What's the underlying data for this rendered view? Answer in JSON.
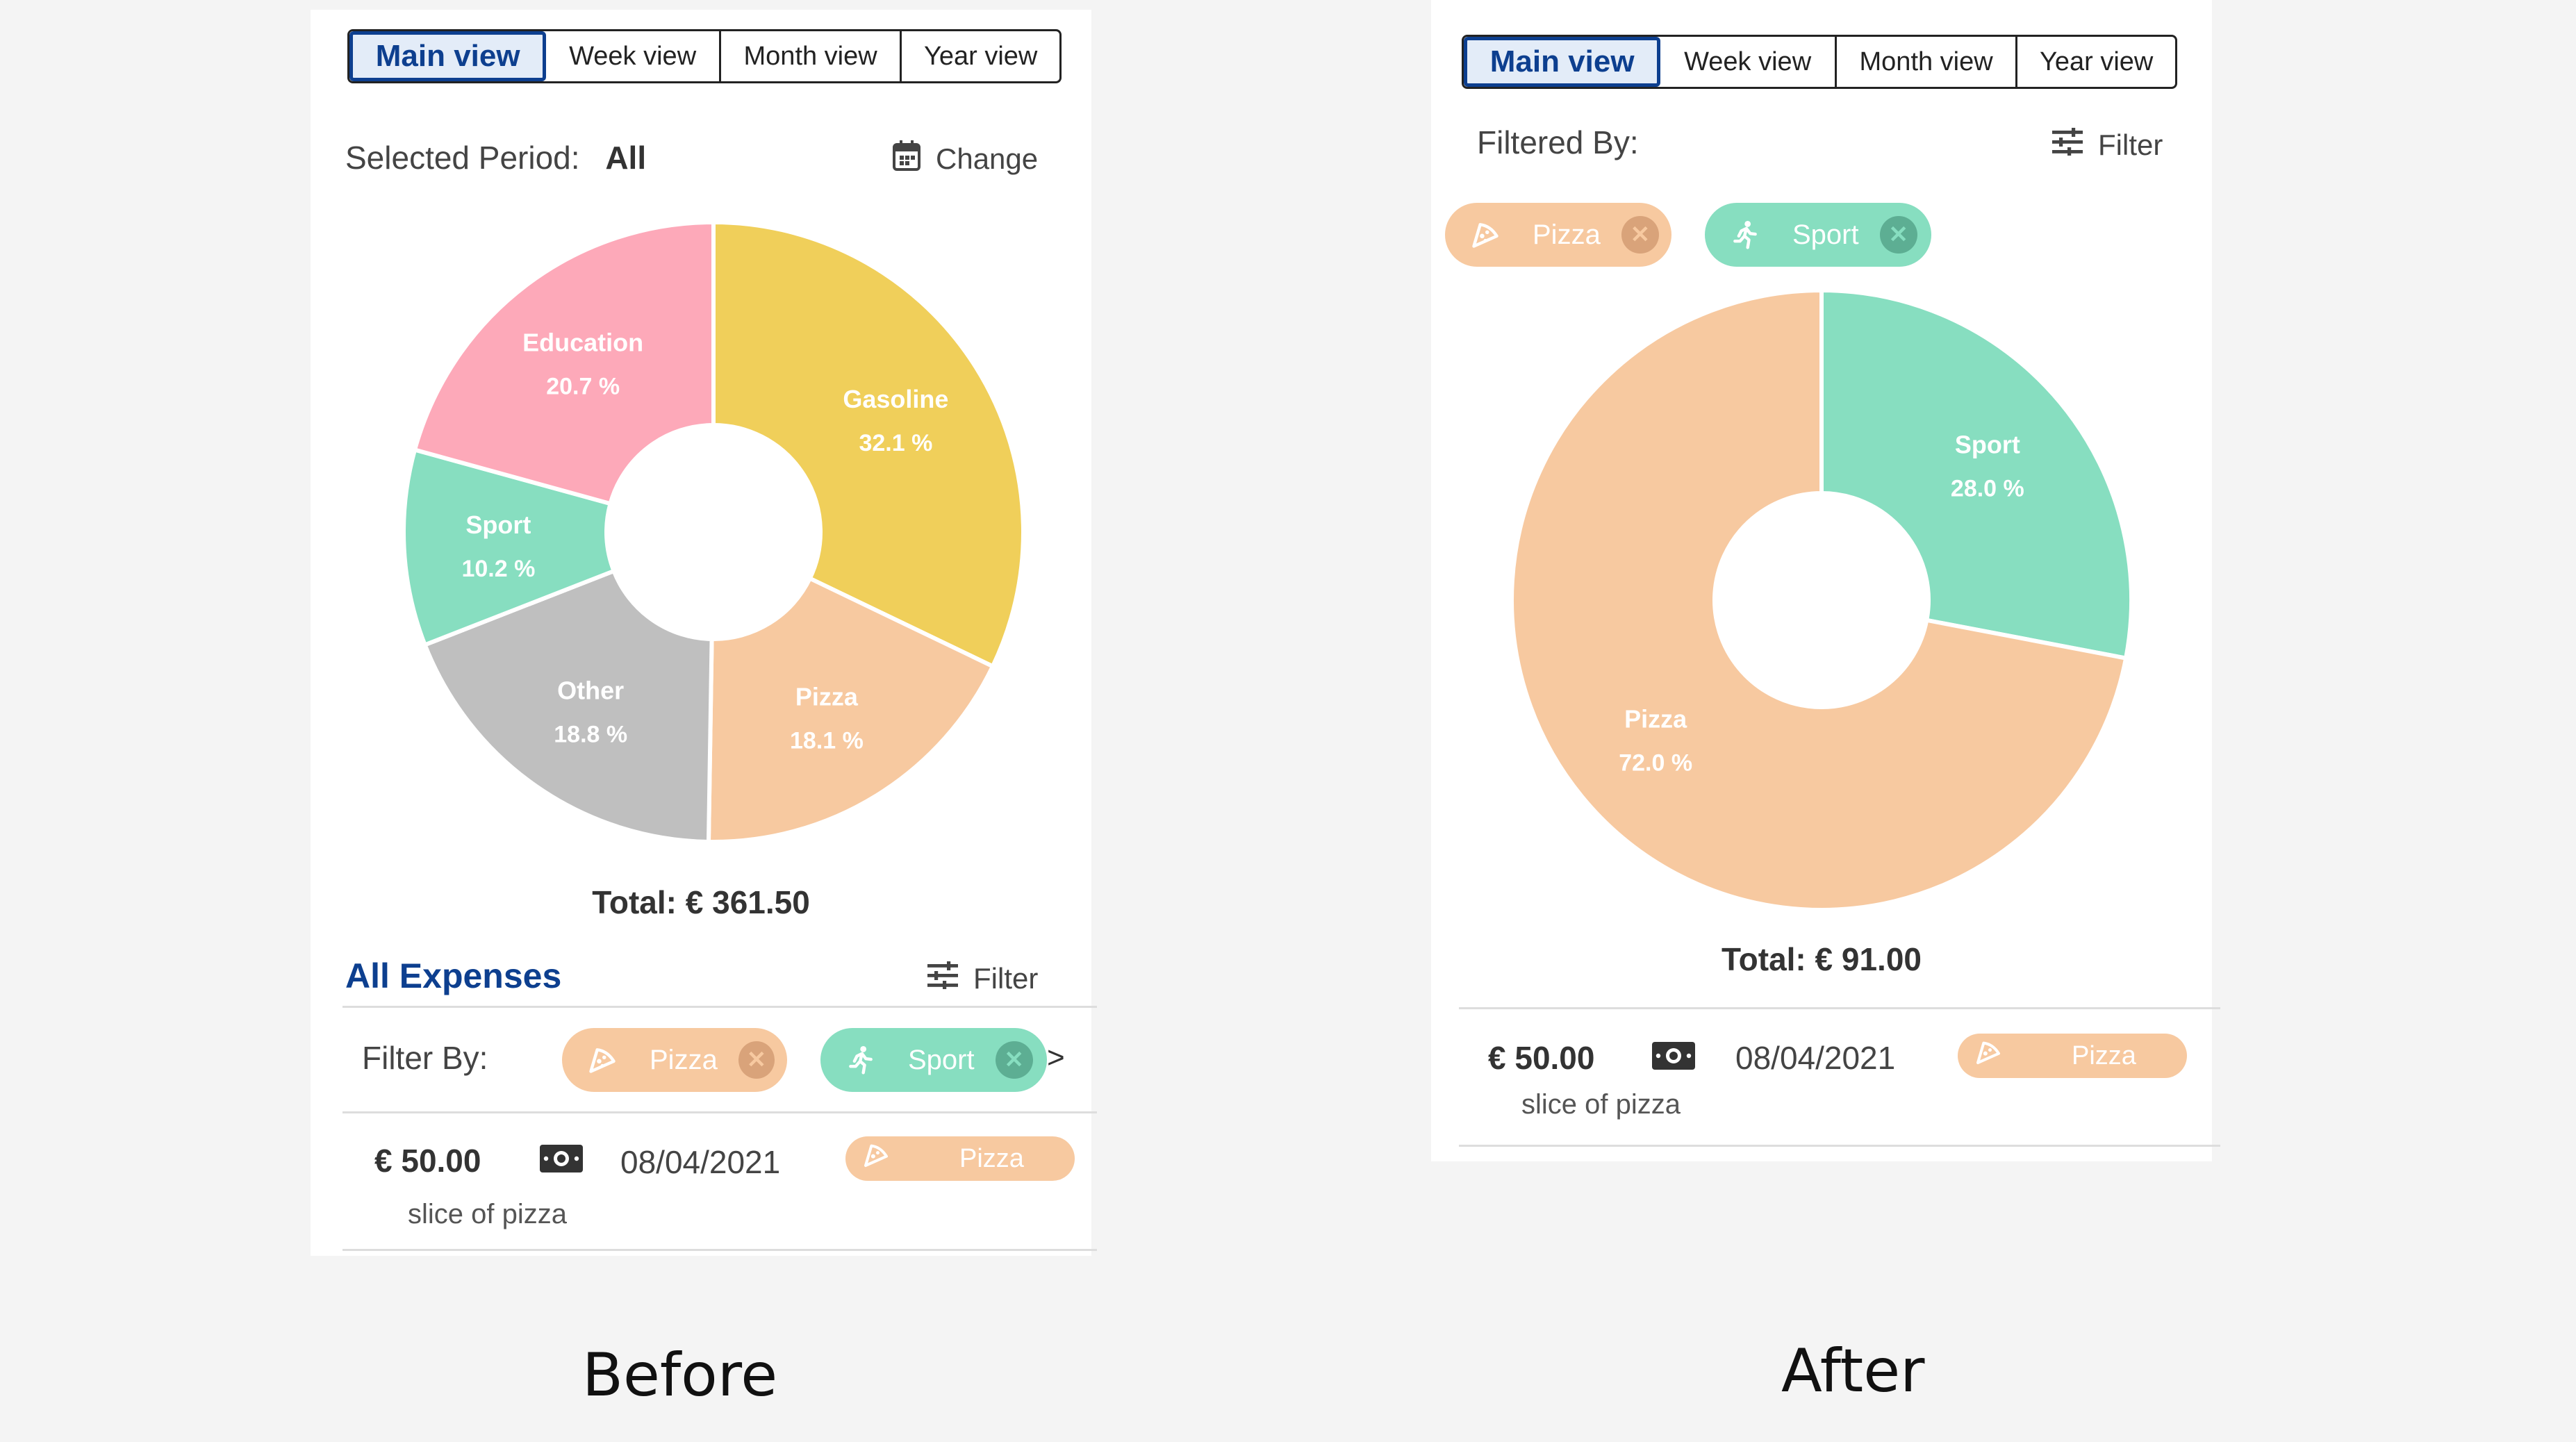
{
  "colors": {
    "Gasoline": "#f0cf5a",
    "Education": "#fda9b9",
    "Sport": "#87dec0",
    "Other": "#bfbfbf",
    "Pizza": "#f7c9a0",
    "accent": "#0d3f8f"
  },
  "tabs": [
    "Main view",
    "Week view",
    "Month view",
    "Year view"
  ],
  "before": {
    "caption": "Before",
    "period_label": "Selected Period:",
    "period_value": "All",
    "change_label": "Change",
    "total": "Total: € 361.50",
    "expenses_title": "All Expenses",
    "filter_label": "Filter",
    "filter_by_label": "Filter By:",
    "chips": [
      {
        "label": "Pizza",
        "icon": "pizza-icon"
      },
      {
        "label": "Sport",
        "icon": "running-icon"
      }
    ],
    "more_indicator": ">",
    "expense": {
      "amount": "€ 50.00",
      "icon": "cash-icon",
      "date": "08/04/2021",
      "category": "Pizza",
      "description": "slice of pizza"
    }
  },
  "after": {
    "caption": "After",
    "filtered_by_label": "Filtered By:",
    "filter_label": "Filter",
    "chips": [
      {
        "label": "Pizza",
        "icon": "pizza-icon"
      },
      {
        "label": "Sport",
        "icon": "running-icon"
      }
    ],
    "total": "Total: € 91.00",
    "expense": {
      "amount": "€ 50.00",
      "icon": "cash-icon",
      "date": "08/04/2021",
      "category": "Pizza",
      "description": "slice of pizza"
    }
  },
  "chart_data": [
    {
      "type": "pie",
      "donut": true,
      "categories": [
        "Gasoline",
        "Pizza",
        "Other",
        "Sport",
        "Education"
      ],
      "values": [
        32.1,
        18.1,
        18.8,
        10.2,
        20.7
      ],
      "labels": [
        "32.1 %",
        "18.1 %",
        "18.8 %",
        "10.2 %",
        "20.7 %"
      ]
    },
    {
      "type": "pie",
      "donut": true,
      "categories": [
        "Sport",
        "Pizza"
      ],
      "values": [
        28.0,
        72.0
      ],
      "labels": [
        "28.0 %",
        "72.0 %"
      ]
    }
  ]
}
